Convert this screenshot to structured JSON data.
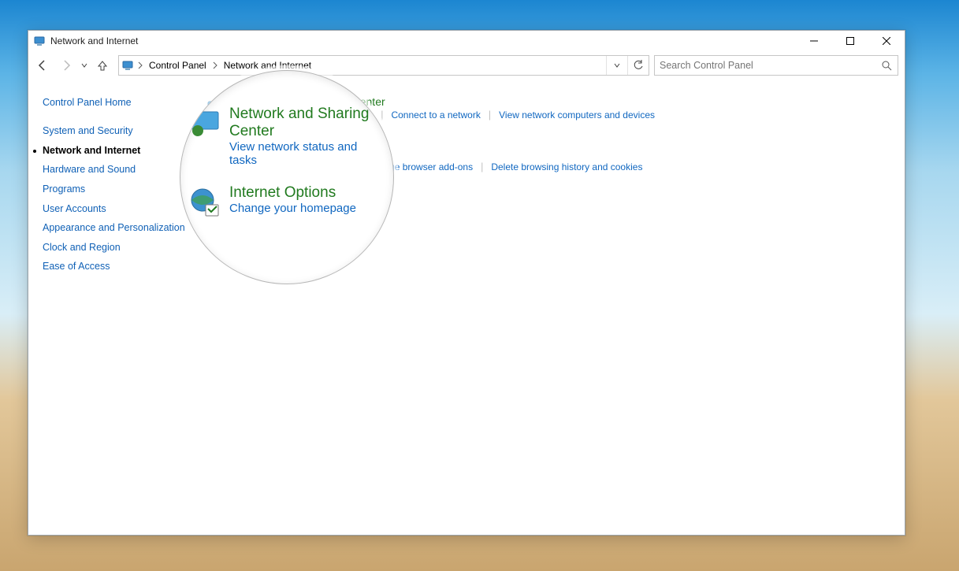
{
  "window": {
    "title": "Network and Internet"
  },
  "breadcrumb": {
    "level1": "Control Panel",
    "level2": "Network and Internet"
  },
  "search": {
    "placeholder": "Search Control Panel"
  },
  "sidebar": {
    "home": "Control Panel Home",
    "items": [
      {
        "label": "System and Security"
      },
      {
        "label": "Network and Internet"
      },
      {
        "label": "Hardware and Sound"
      },
      {
        "label": "Programs"
      },
      {
        "label": "User Accounts"
      },
      {
        "label": "Appearance and Personalization"
      },
      {
        "label": "Clock and Region"
      },
      {
        "label": "Ease of Access"
      }
    ]
  },
  "content": {
    "network_sharing": {
      "heading": "Network and Sharing Center",
      "links": [
        "View network status and tasks",
        "Connect to a network",
        "View network computers and devices"
      ]
    },
    "internet_options": {
      "heading": "Internet Options",
      "links": [
        "Change your homepage",
        "Manage browser add-ons",
        "Delete browsing history and cookies"
      ]
    }
  },
  "magnifier": {
    "row1_heading": "Network and Sharing Center",
    "row1_sub": "View network status and tasks",
    "row2_heading": "Internet Options",
    "row2_sub": "Change your homepage"
  }
}
